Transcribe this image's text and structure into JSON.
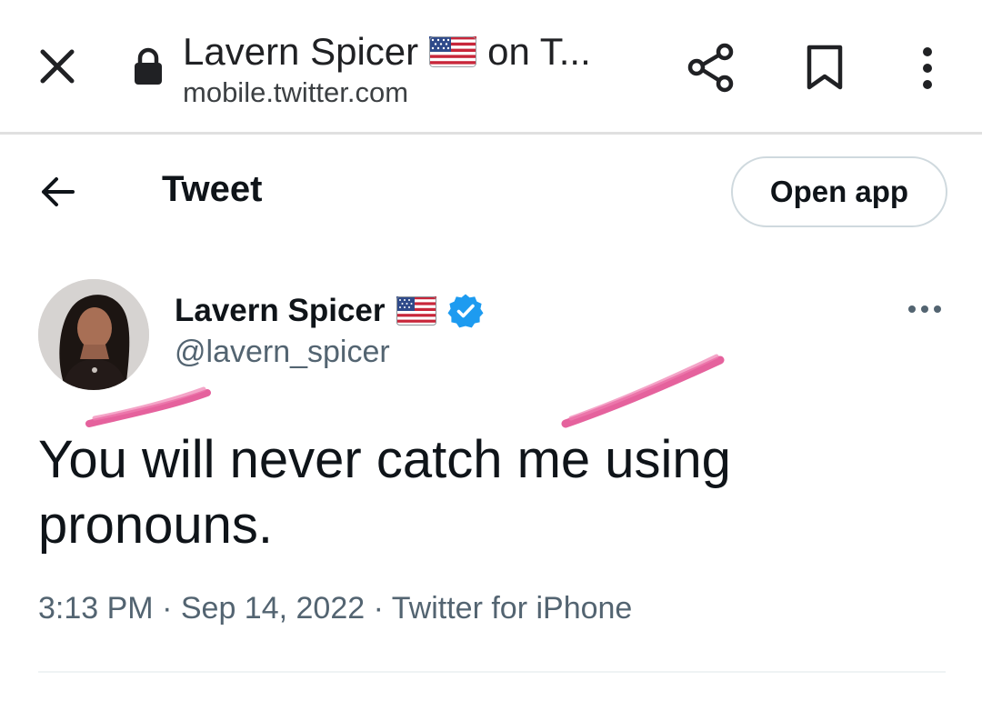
{
  "browser": {
    "title_prefix": "Lavern Spicer",
    "title_suffix": "on T...",
    "url": "mobile.twitter.com",
    "icons": {
      "close": "close-icon",
      "lock": "lock-icon",
      "share": "share-icon",
      "bookmark": "bookmark-icon",
      "more": "more-vertical-icon"
    }
  },
  "header": {
    "title": "Tweet",
    "open_app_label": "Open app",
    "back_icon": "back-arrow-icon"
  },
  "author": {
    "display_name": "Lavern Spicer",
    "handle": "@lavern_spicer",
    "verified": true,
    "flag": "us-flag-icon"
  },
  "tweet": {
    "text": "You will never catch me using pronouns.",
    "time": "3:13 PM",
    "date": "Sep 14, 2022",
    "source": "Twitter for iPhone",
    "separator": "·"
  },
  "colors": {
    "text_primary": "#0f1419",
    "text_secondary": "#536471",
    "verified_blue": "#1d9bf0",
    "highlighter_pink": "#e0468c",
    "border": "#cfd9de"
  }
}
